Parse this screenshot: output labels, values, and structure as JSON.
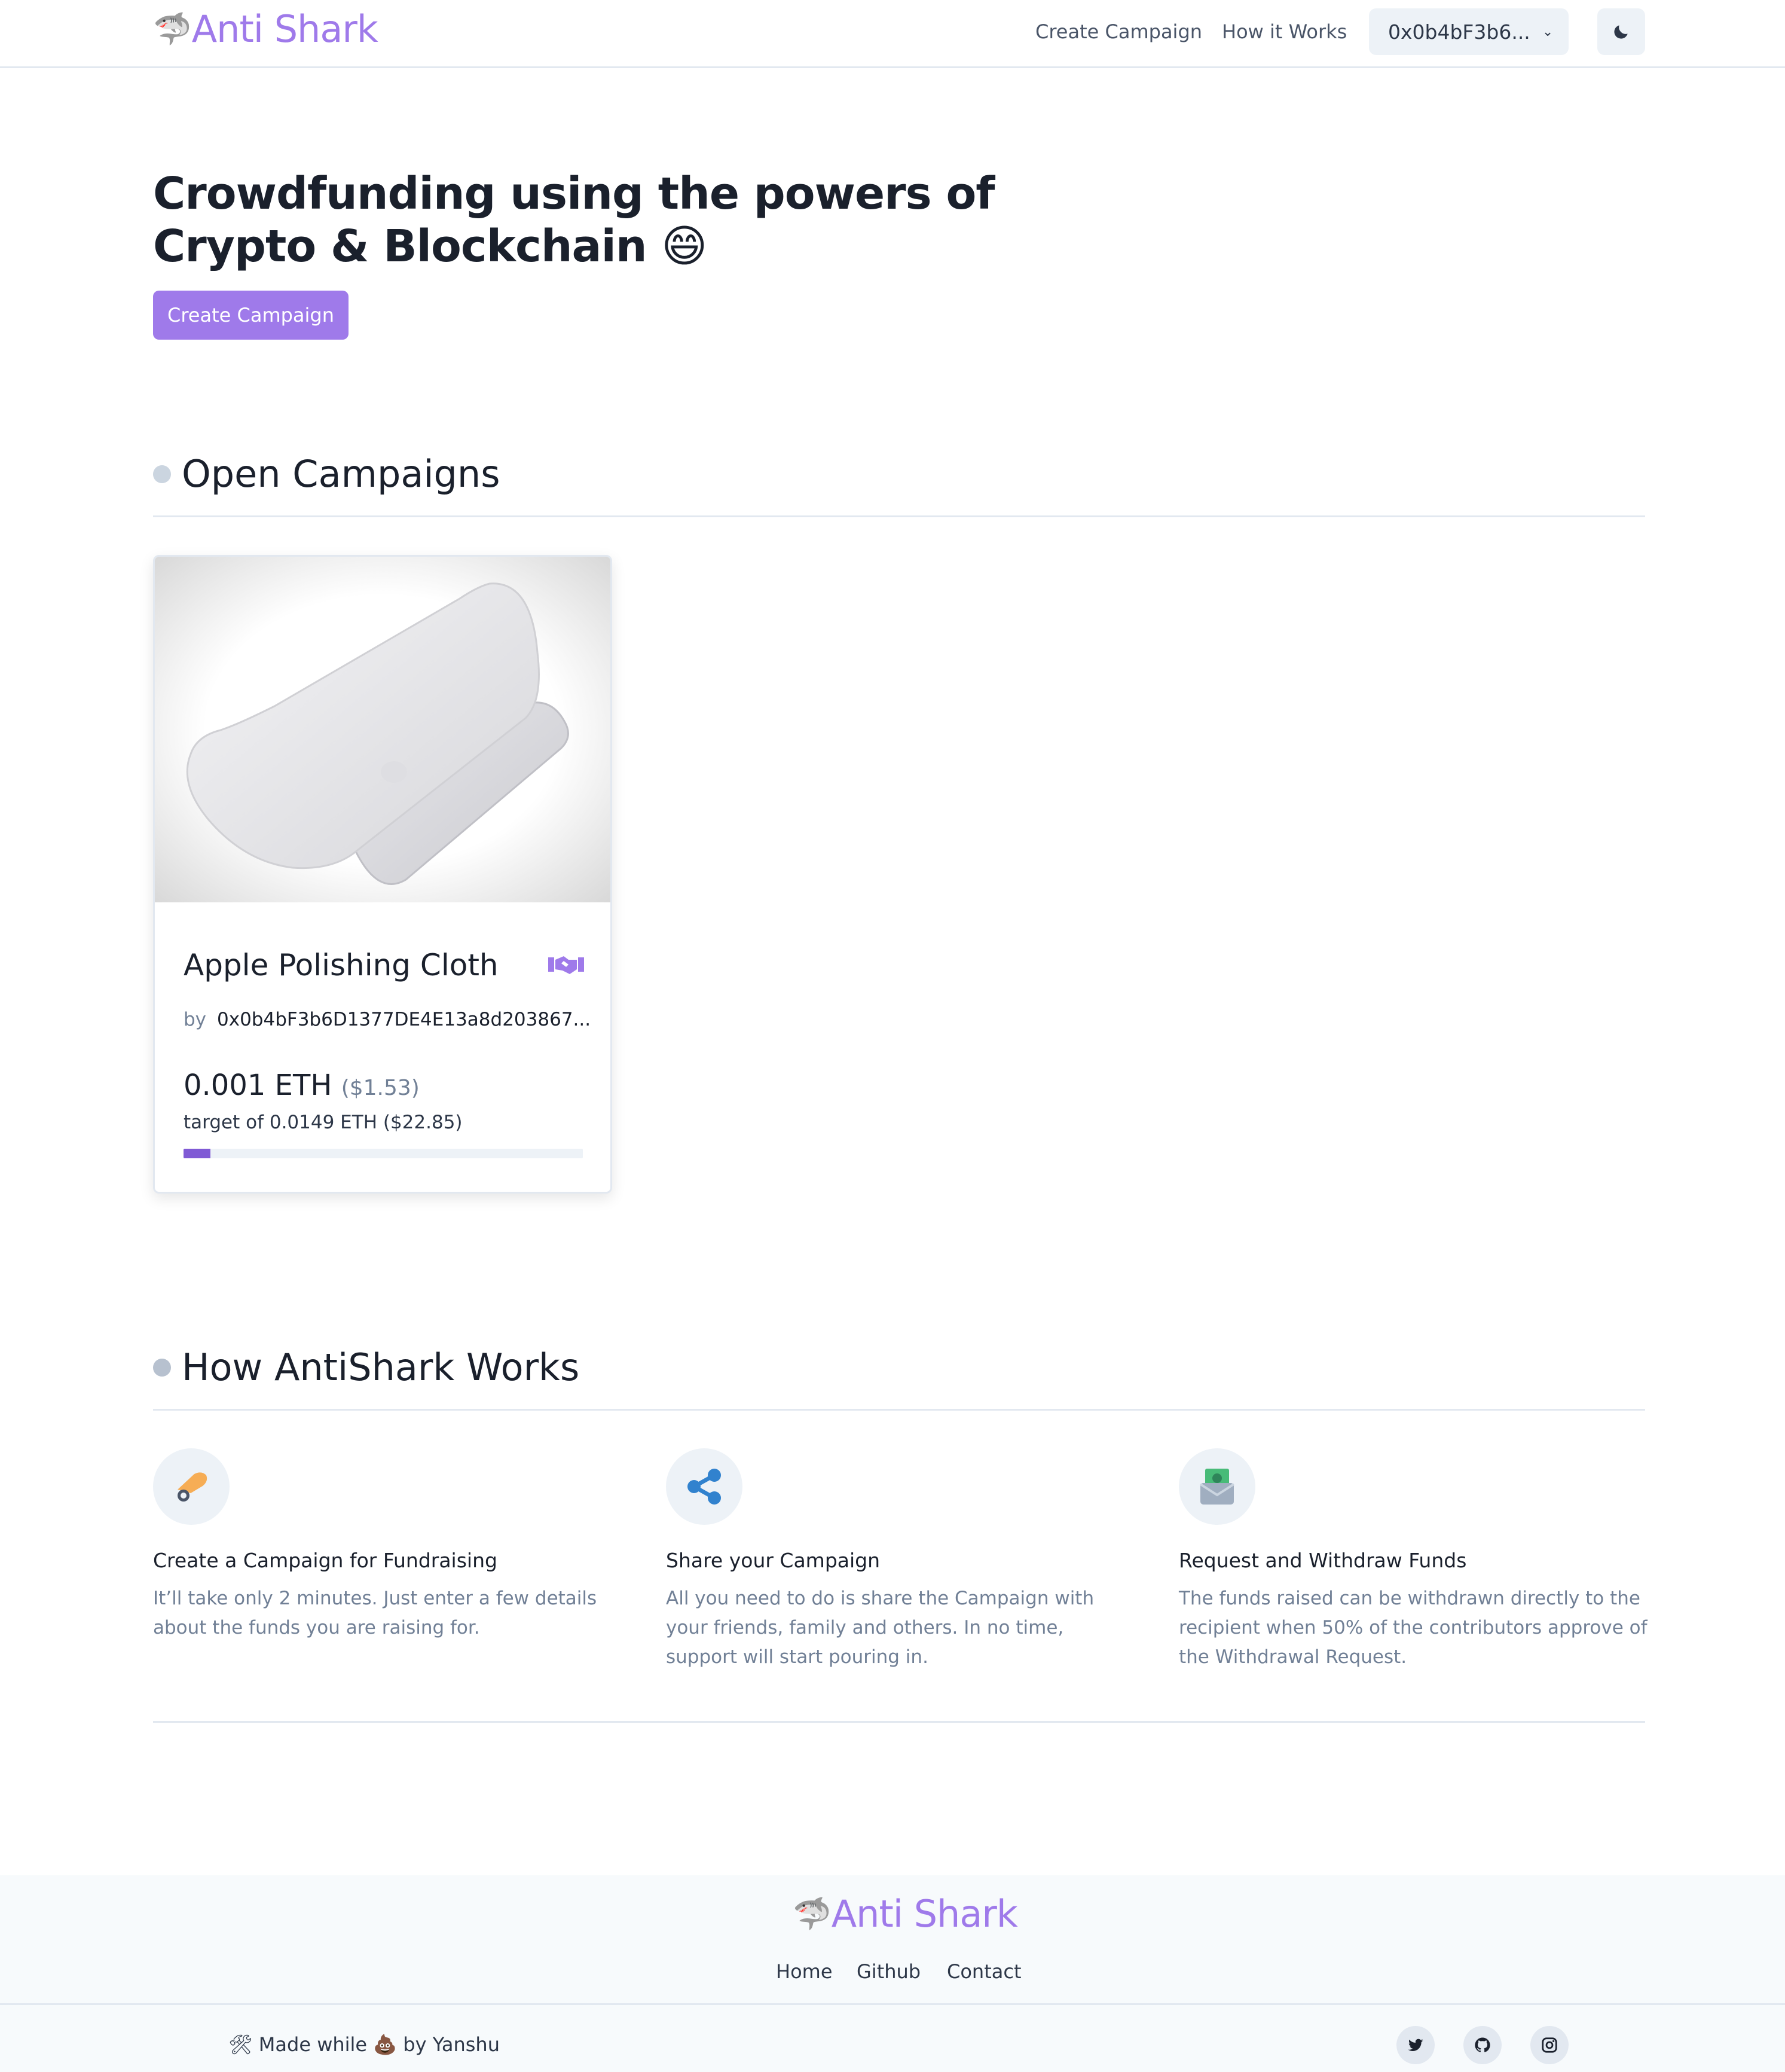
{
  "brand": {
    "name": "Anti Shark",
    "logo_icon": "shark-emoji",
    "accent_color": "#9f7aea"
  },
  "nav": {
    "create_campaign": "Create Campaign",
    "how_it_works": "How it Works",
    "account": "0x0b4bF3b6...",
    "theme_icon": "moon-icon"
  },
  "hero": {
    "title": "Crowdfunding using the powers of Crypto & Blockchain 😄",
    "cta": "Create Campaign"
  },
  "open_campaigns": {
    "heading": "Open Campaigns",
    "cards": [
      {
        "title": "Apple Polishing Cloth",
        "by_label": "by",
        "creator": "0x0b4bF3b6D1377DE4E13a8d203867...",
        "raised": "0.001 ETH",
        "raised_usd": "($1.53)",
        "target": "target of 0.0149 ETH ($22.85)",
        "progress_fraction": 0.067,
        "badge_icon": "handshake-icon",
        "image": "polishing-cloth-image"
      }
    ]
  },
  "how_it_works": {
    "heading": "How AntiShark Works",
    "features": [
      {
        "title": "Create a Campaign for Fundraising",
        "text": "It’ll take only 2 minutes. Just enter a few details about the funds you are raising for.",
        "icon": "hand-coin-icon"
      },
      {
        "title": "Share your Campaign",
        "text": "All you need to do is share the Campaign with your friends, family and others. In no time, support will start pouring in.",
        "icon": "share-icon"
      },
      {
        "title": "Request and Withdraw Funds",
        "text": "The funds raised can be withdrawn directly to the recipient when 50% of the contributors approve of the Withdrawal Request.",
        "icon": "money-envelope-icon"
      }
    ]
  },
  "footer": {
    "links": [
      "Home",
      "Github",
      "Contact"
    ],
    "made_by": "🛠 Made while 💩 by Yanshu",
    "social_icons": [
      "twitter-icon",
      "github-icon",
      "instagram-icon"
    ]
  }
}
